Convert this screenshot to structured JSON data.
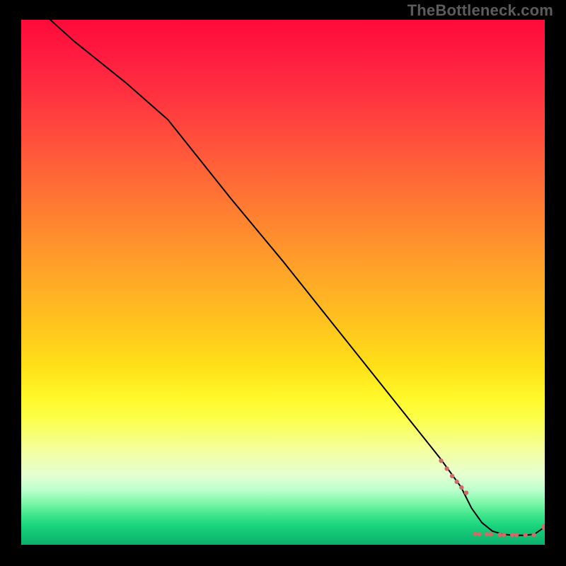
{
  "watermark": "TheBottleneck.com",
  "chart_data": {
    "type": "line",
    "title": "",
    "xlabel": "",
    "ylabel": "",
    "xlim": [
      0,
      100
    ],
    "ylim": [
      0,
      100
    ],
    "grid": false,
    "series": [
      {
        "name": "curve",
        "style": "line",
        "color": "#000000",
        "x": [
          0,
          10,
          20,
          28,
          40,
          50,
          60,
          70,
          80,
          84,
          86,
          88,
          90,
          92,
          94,
          96,
          98,
          100
        ],
        "y": [
          105,
          96,
          88,
          81,
          66,
          54,
          41.5,
          29,
          16.5,
          11,
          7,
          4.2,
          2.6,
          2.0,
          1.8,
          1.8,
          2.0,
          3.4
        ]
      },
      {
        "name": "tail-markers",
        "style": "scatter",
        "color": "#cc6d68",
        "radius_small": 3.2,
        "radius_large": 4.6,
        "x": [
          80.2,
          81.3,
          82.3,
          83.2,
          84.1,
          85.0,
          86.7,
          87.5,
          88.9,
          89.7,
          91.4,
          92.2,
          93.8,
          94.6,
          96.3,
          97.9,
          100
        ],
        "y": [
          16.0,
          14.5,
          13.1,
          12.0,
          10.9,
          9.9,
          2.1,
          2.0,
          2.0,
          2.0,
          1.9,
          1.9,
          1.9,
          1.9,
          1.9,
          1.9,
          3.4
        ],
        "large_indices": [
          16
        ]
      }
    ]
  }
}
